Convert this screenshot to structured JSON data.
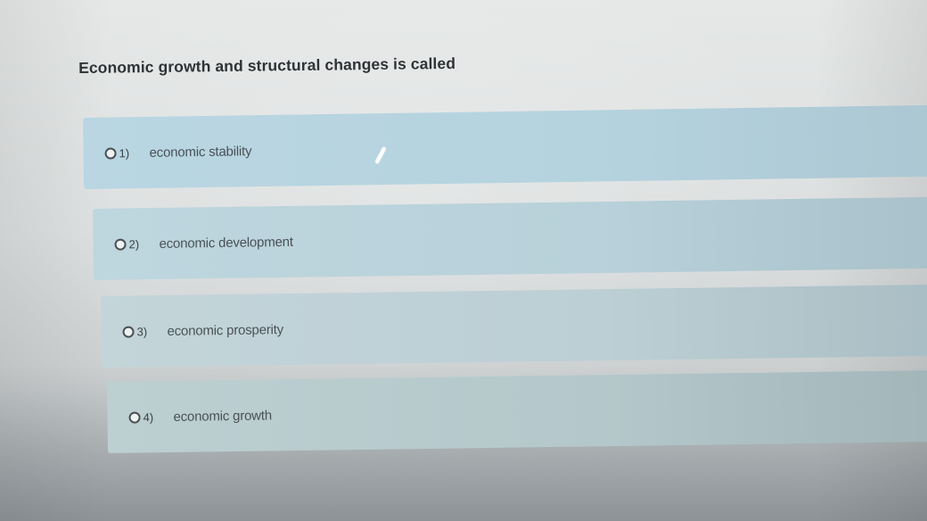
{
  "question": {
    "text": "Economic growth and structural changes is called"
  },
  "options": [
    {
      "number": "1)",
      "label": "economic stability"
    },
    {
      "number": "2)",
      "label": "economic development"
    },
    {
      "number": "3)",
      "label": "economic prosperity"
    },
    {
      "number": "4)",
      "label": "economic growth"
    }
  ],
  "colors": {
    "option_background": "#b9d6e2",
    "question_text": "#2f3336",
    "option_text": "#4a5257"
  }
}
